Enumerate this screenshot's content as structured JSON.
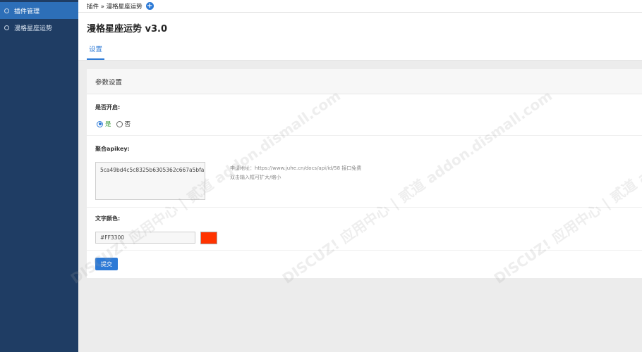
{
  "sidebar": {
    "items": [
      {
        "label": "插件管理"
      },
      {
        "label": "漫格星座运势"
      }
    ]
  },
  "breadcrumb": {
    "text": "插件 » 漫格星座运势",
    "plus_icon": "plus-circle-icon"
  },
  "header": {
    "title": "漫格星座运势 v3.0",
    "tab": "设置"
  },
  "panel": {
    "title": "参数设置",
    "enable_label": "是否开启:",
    "option_yes": "是",
    "option_no": "否",
    "selected": "是",
    "apikey_label": "聚合apikey:",
    "apikey_value": "5ca49bd4c5c8325b6305362c667a5bfa",
    "hint_line1": "申请地址：https://www.juhe.cn/docs/api/id/58 接口免费",
    "hint_line2": "双击输入框可扩大/缩小",
    "color_label": "文字颜色:",
    "color_value": "#FF3300",
    "submit_label": "提交"
  },
  "colors": {
    "accent": "#2d7ad6",
    "sidebar_bg": "#1f3d64",
    "swatch": "#FF3300"
  },
  "watermark": "DISCUZ! 应用中心 | 贰道 addon.dismall.com"
}
